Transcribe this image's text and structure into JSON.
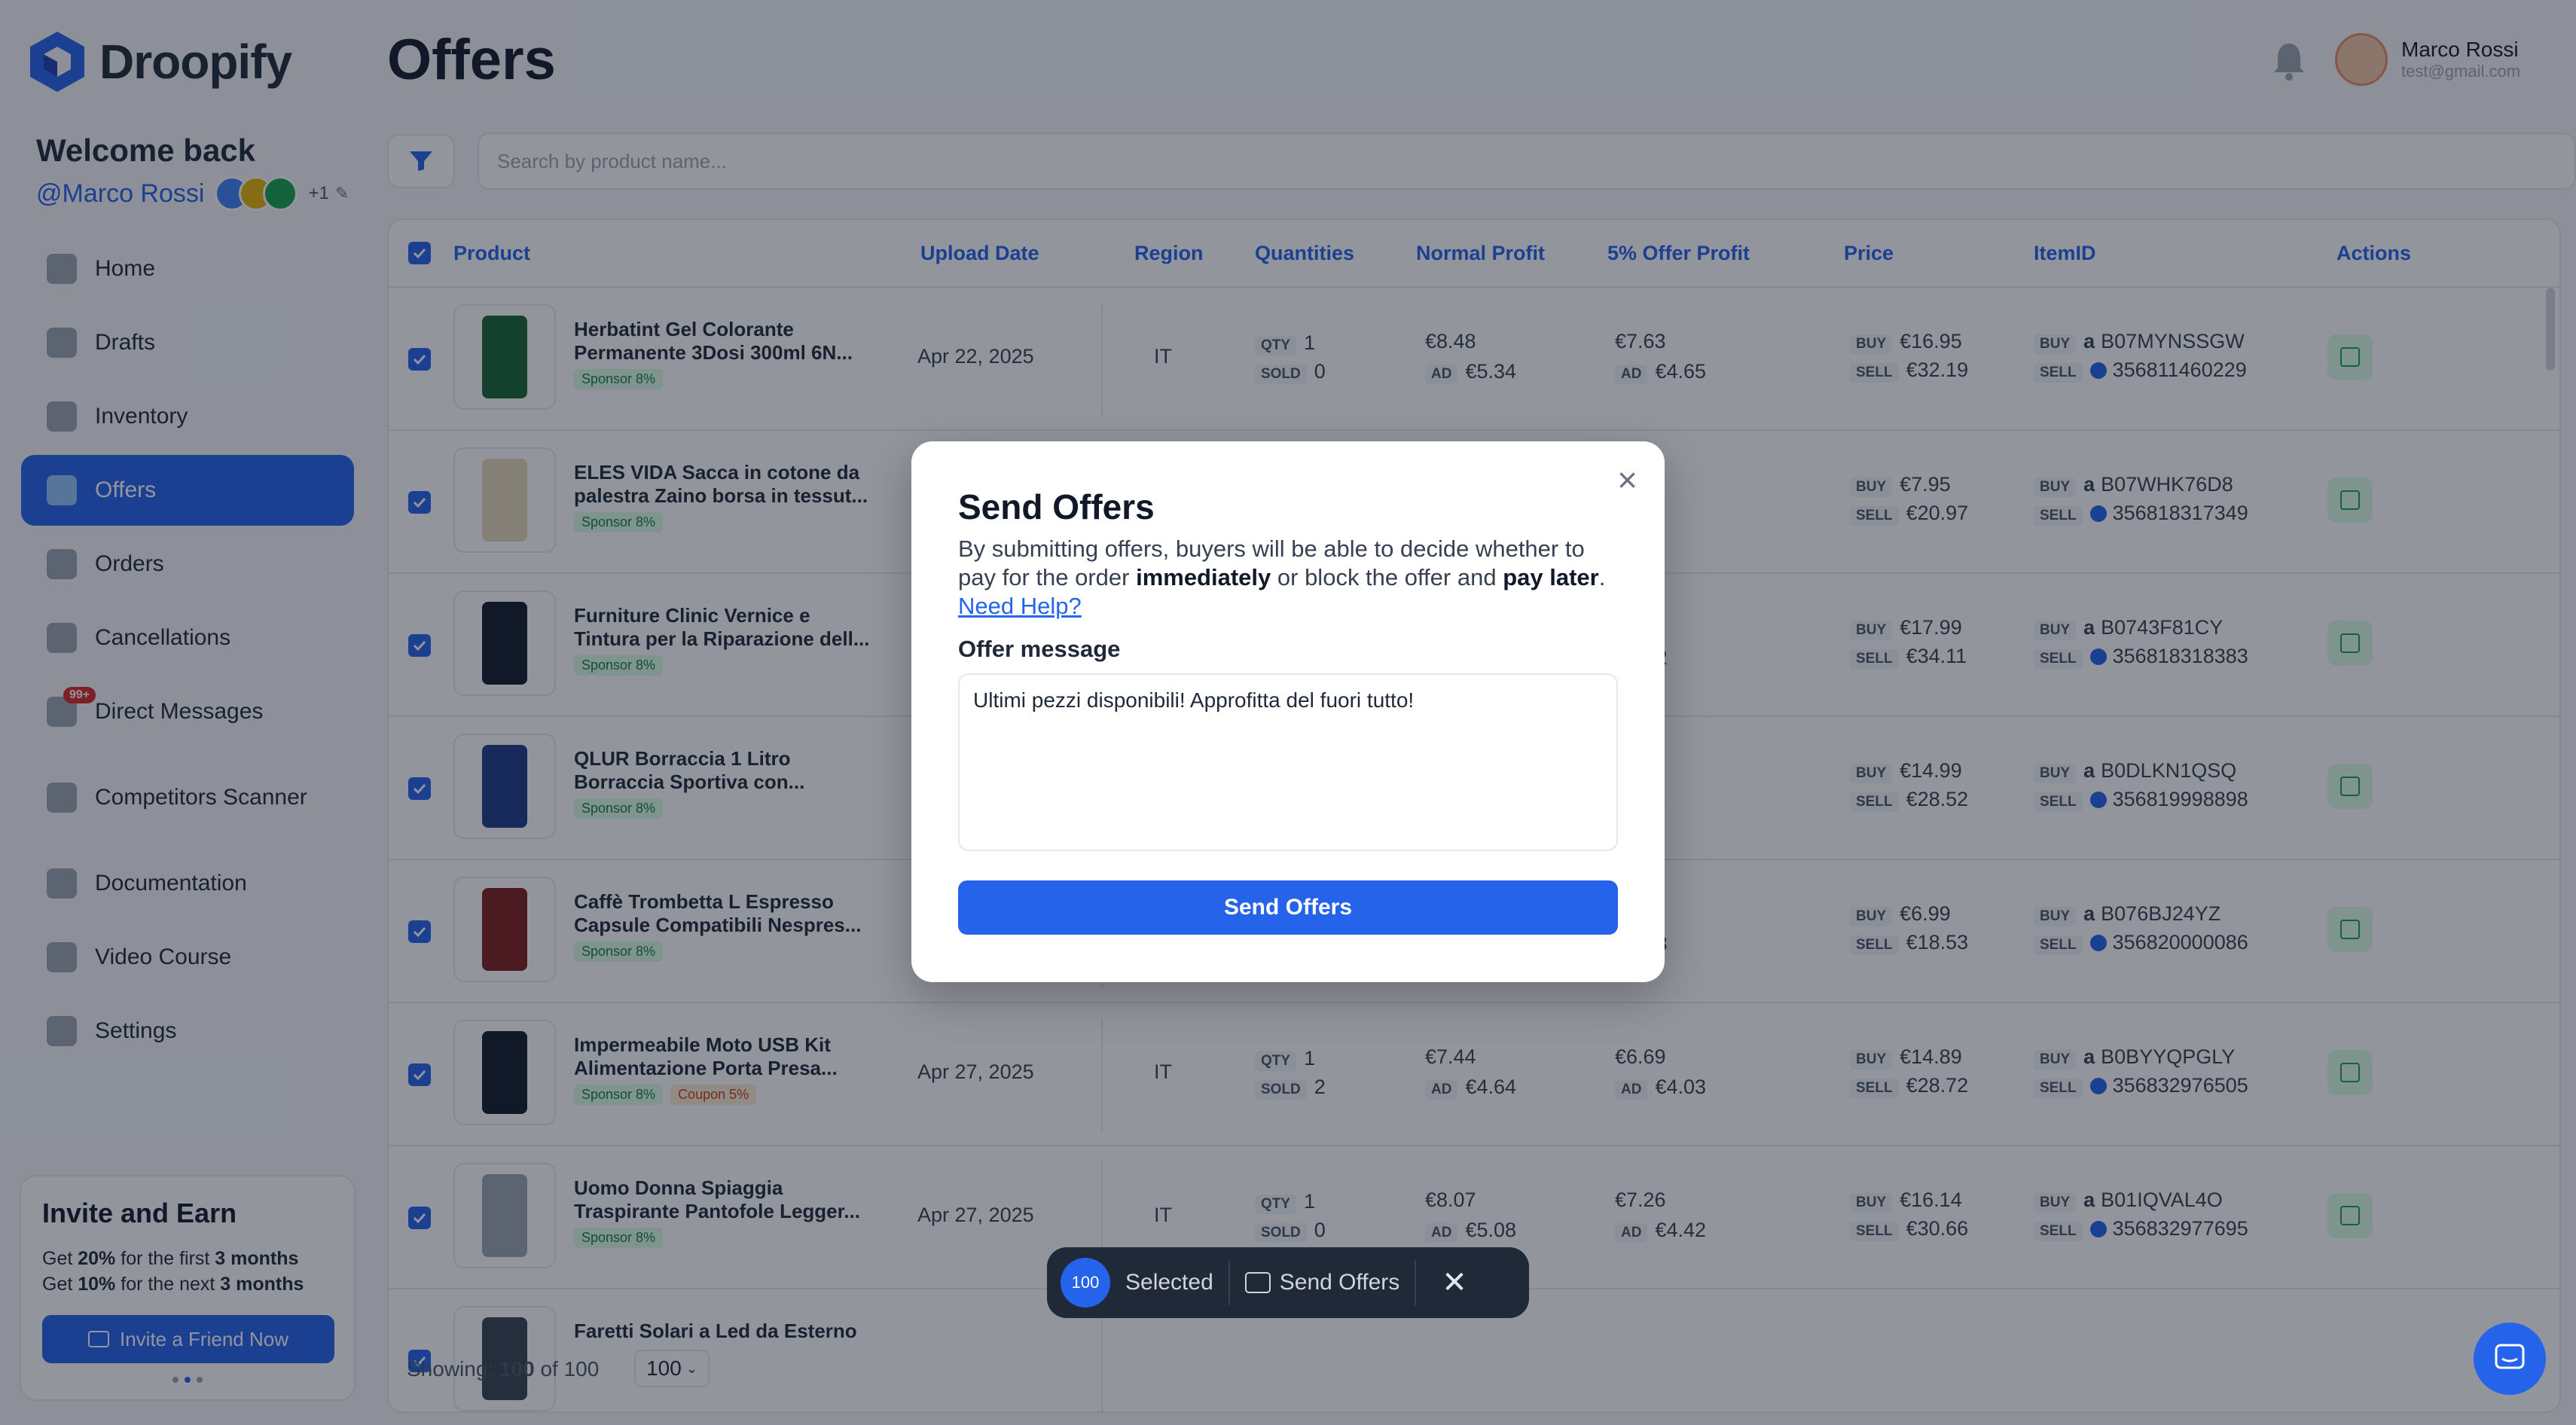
{
  "app": {
    "name": "Droopify"
  },
  "sidebar": {
    "welcome": "Welcome back",
    "handle": "@Marco Rossi",
    "extra_count": "+1",
    "items": [
      {
        "label": "Home",
        "icon": "home-icon"
      },
      {
        "label": "Drafts",
        "icon": "drafts-icon"
      },
      {
        "label": "Inventory",
        "icon": "inventory-icon"
      },
      {
        "label": "Offers",
        "icon": "offers-icon",
        "active": true
      },
      {
        "label": "Orders",
        "icon": "cart-icon"
      },
      {
        "label": "Cancellations",
        "icon": "cancel-icon"
      },
      {
        "label": "Direct Messages",
        "icon": "messages-icon",
        "badge": "99+"
      },
      {
        "label": "Competitors Scanner",
        "icon": "scanner-icon"
      },
      {
        "label": "Documentation",
        "icon": "document-icon"
      },
      {
        "label": "Video Course",
        "icon": "video-icon"
      },
      {
        "label": "Settings",
        "icon": "gear-icon"
      }
    ],
    "invite": {
      "title": "Invite and Earn",
      "line1_pre": "Get ",
      "line1_pct": "20%",
      "line1_mid": " for the first ",
      "line1_dur": "3 months",
      "line2_pre": "Get ",
      "line2_pct": "10%",
      "line2_mid": " for the next ",
      "line2_dur": "3 months",
      "button": "Invite a Friend Now"
    }
  },
  "header": {
    "title": "Offers",
    "user_name": "Marco Rossi",
    "user_email": "test@gmail.com"
  },
  "search": {
    "placeholder": "Search by product name..."
  },
  "table": {
    "columns": [
      "Product",
      "Upload Date",
      "Region",
      "Quantities",
      "Normal Profit",
      "5% Offer Profit",
      "Price",
      "ItemID",
      "Actions"
    ],
    "labels": {
      "qty": "QTY",
      "sold": "SOLD",
      "ad": "AD",
      "buy": "BUY",
      "sell": "SELL"
    },
    "rows": [
      {
        "name": "Herbatint Gel Colorante Permanente 3Dosi 300ml 6N...",
        "tags": [
          "Sponsor 8%"
        ],
        "date": "Apr 22, 2025",
        "region": "IT",
        "qty": "1",
        "sold": "0",
        "profit": "€8.48",
        "profit_ad": "€5.34",
        "offer": "€7.63",
        "offer_ad": "€4.65",
        "buy": "€16.95",
        "sell": "€32.19",
        "asin": "B07MYNSSGW",
        "ebay": "356811460229"
      },
      {
        "name": "ELES VIDA Sacca in cotone da palestra Zaino borsa in tessut...",
        "tags": [
          "Sponsor 8%"
        ],
        "date": "",
        "region": "",
        "qty": "",
        "sold": "",
        "profit": "",
        "profit_ad": "",
        "offer": "",
        "offer_ad": "2",
        "buy": "€7.95",
        "sell": "€20.97",
        "asin": "B07WHK76D8",
        "ebay": "356818317349"
      },
      {
        "name": "Furniture Clinic Vernice e Tintura per la Riparazione dell...",
        "tags": [
          "Sponsor 8%"
        ],
        "date": "",
        "region": "",
        "qty": "",
        "sold": "",
        "profit": "",
        "profit_ad": "",
        "offer": "",
        "offer_ad": ".92",
        "buy": "€17.99",
        "sell": "€34.11",
        "asin": "B0743F81CY",
        "ebay": "356818318383"
      },
      {
        "name": "QLUR Borraccia 1 Litro Borraccia Sportiva con...",
        "tags": [
          "Sponsor 8%"
        ],
        "date": "",
        "region": "",
        "qty": "",
        "sold": "",
        "profit": "",
        "profit_ad": "",
        "offer": "",
        "offer_ad": ".11",
        "buy": "€14.99",
        "sell": "€28.52",
        "asin": "B0DLKN1QSQ",
        "ebay": "356819998898"
      },
      {
        "name": "Caffè Trombetta L Espresso Capsule Compatibili Nespres...",
        "tags": [
          "Sponsor 8%"
        ],
        "date": "",
        "region": "",
        "qty": "",
        "sold": "",
        "profit": "",
        "profit_ad": "",
        "offer": "",
        "offer_ad": ".58",
        "buy": "€6.99",
        "sell": "€18.53",
        "asin": "B076BJ24YZ",
        "ebay": "356820000086"
      },
      {
        "name": "Impermeabile Moto USB Kit Alimentazione Porta Presa...",
        "tags": [
          "Sponsor 8%",
          "Coupon 5%"
        ],
        "date": "Apr 27, 2025",
        "region": "IT",
        "qty": "1",
        "sold": "2",
        "profit": "€7.44",
        "profit_ad": "€4.64",
        "offer": "€6.69",
        "offer_ad": "€4.03",
        "buy": "€14.89",
        "sell": "€28.72",
        "asin": "B0BYYQPGLY",
        "ebay": "356832976505"
      },
      {
        "name": "Uomo Donna Spiaggia Traspirante Pantofole Legger...",
        "tags": [
          "Sponsor 8%"
        ],
        "date": "Apr 27, 2025",
        "region": "IT",
        "qty": "1",
        "sold": "0",
        "profit": "€8.07",
        "profit_ad": "€5.08",
        "offer": "€7.26",
        "offer_ad": "€4.42",
        "buy": "€16.14",
        "sell": "€30.66",
        "asin": "B01IQVAL4O",
        "ebay": "356832977695"
      },
      {
        "name": "Faretti Solari a Led da Esterno",
        "tags": [],
        "date": "",
        "region": "",
        "qty": "",
        "sold": "",
        "profit": "",
        "profit_ad": "",
        "offer": "",
        "offer_ad": "",
        "buy": "",
        "sell": "",
        "asin": "",
        "ebay": ""
      }
    ]
  },
  "footer": {
    "showing": "Showing:",
    "shown": "100",
    "of": "of 100",
    "page_size": "100"
  },
  "bulkbar": {
    "count": "100",
    "selected": "Selected",
    "send": "Send Offers"
  },
  "modal": {
    "title": "Send Offers",
    "desc_1": "By submitting offers, buyers will be able to decide whether to pay for the order ",
    "desc_bold1": "immediately",
    "desc_2": " or block the offer and ",
    "desc_bold2": "pay later",
    "desc_3": ". ",
    "help_link": "Need Help?",
    "label": "Offer message",
    "message": "Ultimi pezzi disponibili! Approfitta del fuori tutto!",
    "button": "Send Offers"
  },
  "colors": {
    "primary": "#2563eb",
    "sponsor": "#15803d",
    "coupon": "#c2410c",
    "danger": "#dc2626"
  }
}
